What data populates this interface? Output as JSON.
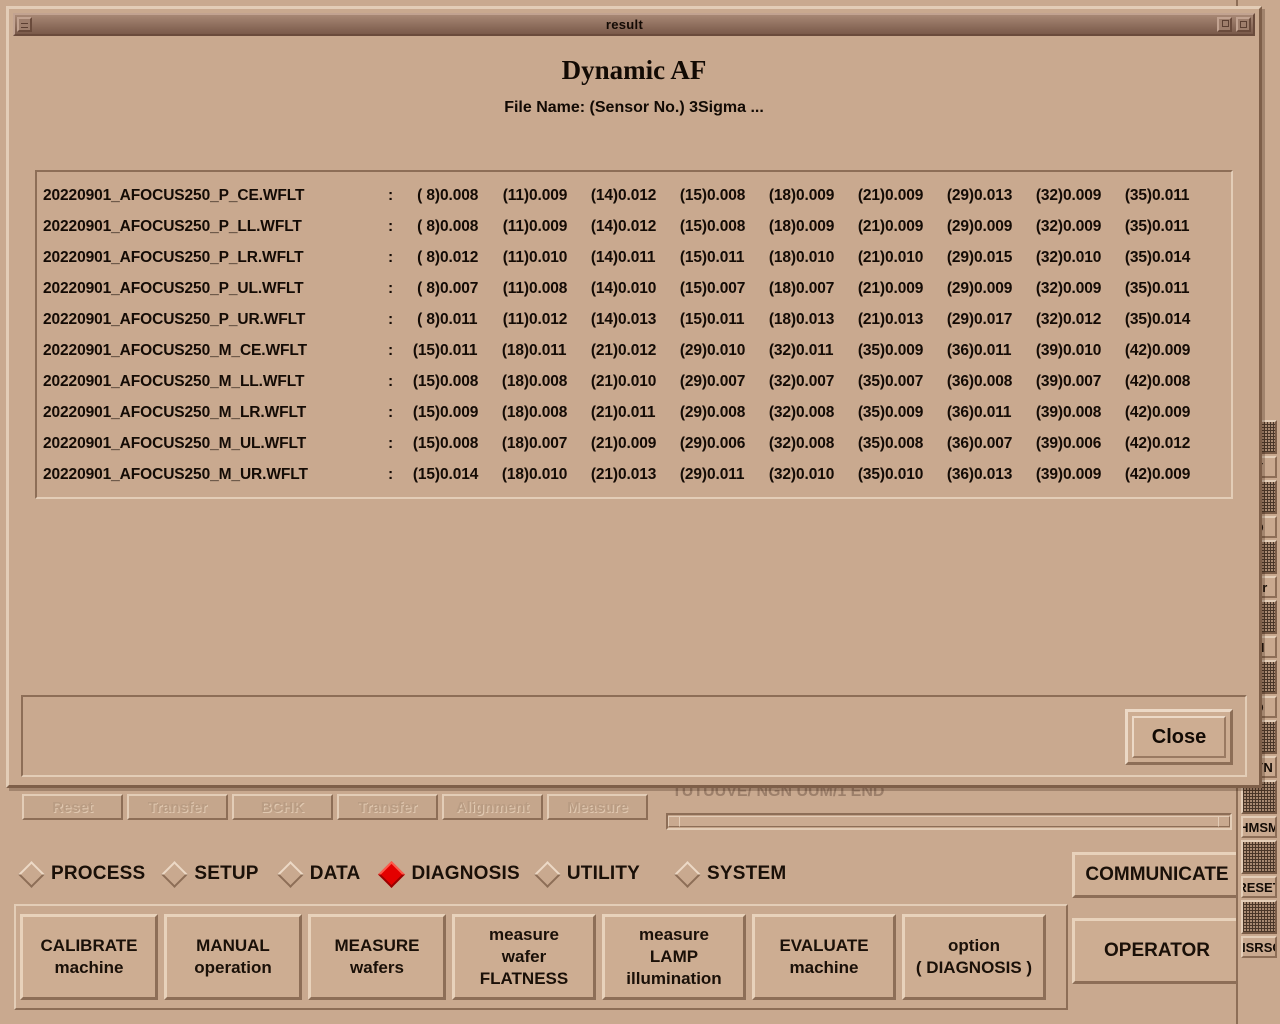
{
  "dialog": {
    "window_title": "result",
    "heading": "Dynamic AF",
    "subheading": "File Name: (Sensor No.) 3Sigma ...",
    "close_label": "Close",
    "titlebar_buttons": [
      {
        "name": "window-menu-button",
        "glyph": "menu"
      },
      {
        "name": "minimize-button",
        "glyph": "min"
      },
      {
        "name": "maximize-button",
        "glyph": "max"
      }
    ]
  },
  "table": {
    "rows": [
      {
        "file": "20220901_AFOCUS250_P_CE.WFLT",
        "cells": [
          {
            "sensor": "( 8)",
            "value": "0.008"
          },
          {
            "sensor": "(11)",
            "value": "0.009"
          },
          {
            "sensor": "(14)",
            "value": "0.012"
          },
          {
            "sensor": "(15)",
            "value": "0.008"
          },
          {
            "sensor": "(18)",
            "value": "0.009"
          },
          {
            "sensor": "(21)",
            "value": "0.009"
          },
          {
            "sensor": "(29)",
            "value": "0.013"
          },
          {
            "sensor": "(32)",
            "value": "0.009"
          },
          {
            "sensor": "(35)",
            "value": "0.011"
          }
        ]
      },
      {
        "file": "20220901_AFOCUS250_P_LL.WFLT",
        "cells": [
          {
            "sensor": "( 8)",
            "value": "0.008"
          },
          {
            "sensor": "(11)",
            "value": "0.009"
          },
          {
            "sensor": "(14)",
            "value": "0.012"
          },
          {
            "sensor": "(15)",
            "value": "0.008"
          },
          {
            "sensor": "(18)",
            "value": "0.009"
          },
          {
            "sensor": "(21)",
            "value": "0.009"
          },
          {
            "sensor": "(29)",
            "value": "0.009"
          },
          {
            "sensor": "(32)",
            "value": "0.009"
          },
          {
            "sensor": "(35)",
            "value": "0.011"
          }
        ]
      },
      {
        "file": "20220901_AFOCUS250_P_LR.WFLT",
        "cells": [
          {
            "sensor": "( 8)",
            "value": "0.012"
          },
          {
            "sensor": "(11)",
            "value": "0.010"
          },
          {
            "sensor": "(14)",
            "value": "0.011"
          },
          {
            "sensor": "(15)",
            "value": "0.011"
          },
          {
            "sensor": "(18)",
            "value": "0.010"
          },
          {
            "sensor": "(21)",
            "value": "0.010"
          },
          {
            "sensor": "(29)",
            "value": "0.015"
          },
          {
            "sensor": "(32)",
            "value": "0.010"
          },
          {
            "sensor": "(35)",
            "value": "0.014"
          }
        ]
      },
      {
        "file": "20220901_AFOCUS250_P_UL.WFLT",
        "cells": [
          {
            "sensor": "( 8)",
            "value": "0.007"
          },
          {
            "sensor": "(11)",
            "value": "0.008"
          },
          {
            "sensor": "(14)",
            "value": "0.010"
          },
          {
            "sensor": "(15)",
            "value": "0.007"
          },
          {
            "sensor": "(18)",
            "value": "0.007"
          },
          {
            "sensor": "(21)",
            "value": "0.009"
          },
          {
            "sensor": "(29)",
            "value": "0.009"
          },
          {
            "sensor": "(32)",
            "value": "0.009"
          },
          {
            "sensor": "(35)",
            "value": "0.011"
          }
        ]
      },
      {
        "file": "20220901_AFOCUS250_P_UR.WFLT",
        "cells": [
          {
            "sensor": "( 8)",
            "value": "0.011"
          },
          {
            "sensor": "(11)",
            "value": "0.012"
          },
          {
            "sensor": "(14)",
            "value": "0.013"
          },
          {
            "sensor": "(15)",
            "value": "0.011"
          },
          {
            "sensor": "(18)",
            "value": "0.013"
          },
          {
            "sensor": "(21)",
            "value": "0.013"
          },
          {
            "sensor": "(29)",
            "value": "0.017"
          },
          {
            "sensor": "(32)",
            "value": "0.012"
          },
          {
            "sensor": "(35)",
            "value": "0.014"
          }
        ]
      },
      {
        "file": "20220901_AFOCUS250_M_CE.WFLT",
        "cells": [
          {
            "sensor": "(15)",
            "value": "0.011"
          },
          {
            "sensor": "(18)",
            "value": "0.011"
          },
          {
            "sensor": "(21)",
            "value": "0.012"
          },
          {
            "sensor": "(29)",
            "value": "0.010"
          },
          {
            "sensor": "(32)",
            "value": "0.011"
          },
          {
            "sensor": "(35)",
            "value": "0.009"
          },
          {
            "sensor": "(36)",
            "value": "0.011"
          },
          {
            "sensor": "(39)",
            "value": "0.010"
          },
          {
            "sensor": "(42)",
            "value": "0.009"
          }
        ]
      },
      {
        "file": "20220901_AFOCUS250_M_LL.WFLT",
        "cells": [
          {
            "sensor": "(15)",
            "value": "0.008"
          },
          {
            "sensor": "(18)",
            "value": "0.008"
          },
          {
            "sensor": "(21)",
            "value": "0.010"
          },
          {
            "sensor": "(29)",
            "value": "0.007"
          },
          {
            "sensor": "(32)",
            "value": "0.007"
          },
          {
            "sensor": "(35)",
            "value": "0.007"
          },
          {
            "sensor": "(36)",
            "value": "0.008"
          },
          {
            "sensor": "(39)",
            "value": "0.007"
          },
          {
            "sensor": "(42)",
            "value": "0.008"
          }
        ]
      },
      {
        "file": "20220901_AFOCUS250_M_LR.WFLT",
        "cells": [
          {
            "sensor": "(15)",
            "value": "0.009"
          },
          {
            "sensor": "(18)",
            "value": "0.008"
          },
          {
            "sensor": "(21)",
            "value": "0.011"
          },
          {
            "sensor": "(29)",
            "value": "0.008"
          },
          {
            "sensor": "(32)",
            "value": "0.008"
          },
          {
            "sensor": "(35)",
            "value": "0.009"
          },
          {
            "sensor": "(36)",
            "value": "0.011"
          },
          {
            "sensor": "(39)",
            "value": "0.008"
          },
          {
            "sensor": "(42)",
            "value": "0.009"
          }
        ]
      },
      {
        "file": "20220901_AFOCUS250_M_UL.WFLT",
        "cells": [
          {
            "sensor": "(15)",
            "value": "0.008"
          },
          {
            "sensor": "(18)",
            "value": "0.007"
          },
          {
            "sensor": "(21)",
            "value": "0.009"
          },
          {
            "sensor": "(29)",
            "value": "0.006"
          },
          {
            "sensor": "(32)",
            "value": "0.008"
          },
          {
            "sensor": "(35)",
            "value": "0.008"
          },
          {
            "sensor": "(36)",
            "value": "0.007"
          },
          {
            "sensor": "(39)",
            "value": "0.006"
          },
          {
            "sensor": "(42)",
            "value": "0.012"
          }
        ]
      },
      {
        "file": "20220901_AFOCUS250_M_UR.WFLT",
        "cells": [
          {
            "sensor": "(15)",
            "value": "0.014"
          },
          {
            "sensor": "(18)",
            "value": "0.010"
          },
          {
            "sensor": "(21)",
            "value": "0.013"
          },
          {
            "sensor": "(29)",
            "value": "0.011"
          },
          {
            "sensor": "(32)",
            "value": "0.010"
          },
          {
            "sensor": "(35)",
            "value": "0.010"
          },
          {
            "sensor": "(36)",
            "value": "0.013"
          },
          {
            "sensor": "(39)",
            "value": "0.009"
          },
          {
            "sensor": "(42)",
            "value": "0.009"
          }
        ]
      }
    ]
  },
  "app": {
    "tabs": [
      {
        "label": "Reset",
        "enabled": false
      },
      {
        "label": "Transfer",
        "enabled": false
      },
      {
        "label": "BCHK",
        "enabled": false
      },
      {
        "label": "Transfer",
        "enabled": false
      },
      {
        "label": "Alignment",
        "enabled": false
      },
      {
        "label": "Measure",
        "enabled": false
      }
    ],
    "message_line": "TUTUUVE/  NGN  UUM/1  END",
    "modes": [
      {
        "label": "PROCESS",
        "selected": false
      },
      {
        "label": "SETUP",
        "selected": false
      },
      {
        "label": "DATA",
        "selected": false
      },
      {
        "label": "DIAGNOSIS",
        "selected": true
      },
      {
        "label": "UTILITY",
        "selected": false
      },
      {
        "label": "SYSTEM",
        "selected": false
      }
    ],
    "selected_color": "#e40000",
    "function_buttons": [
      "CALIBRATE\nmachine",
      "MANUAL\noperation",
      "MEASURE\nwafers",
      "measure\nwafer\nFLATNESS",
      "measure\nLAMP\nillumination",
      "EVALUATE\nmachine",
      "option\n( DIAGNOSIS )"
    ],
    "communicate_label": "COMMUNICATE",
    "operator_label": "OPERATOR",
    "right_strip": [
      {
        "type": "icon",
        "name": "status-icon-1"
      },
      {
        "type": "label",
        "text": "Y"
      },
      {
        "type": "icon",
        "name": "status-icon-2"
      },
      {
        "type": "label",
        "text": "D"
      },
      {
        "type": "icon",
        "name": "status-icon-3"
      },
      {
        "type": "label",
        "text": "ter"
      },
      {
        "type": "icon",
        "name": "status-icon-4"
      },
      {
        "type": "label",
        "text": "M"
      },
      {
        "type": "icon",
        "name": "status-icon-5"
      },
      {
        "type": "label",
        "text": "D"
      },
      {
        "type": "icon",
        "name": "status-icon-6"
      },
      {
        "type": "label",
        "text": "DYN"
      },
      {
        "type": "icon",
        "name": "hmsm-icon"
      },
      {
        "type": "label",
        "text": "HMSM"
      },
      {
        "type": "icon",
        "name": "reset-icon"
      },
      {
        "type": "label",
        "text": "RESET"
      },
      {
        "type": "icon",
        "name": "nsrsc-icon"
      },
      {
        "type": "label",
        "text": "NSRSC"
      }
    ]
  }
}
